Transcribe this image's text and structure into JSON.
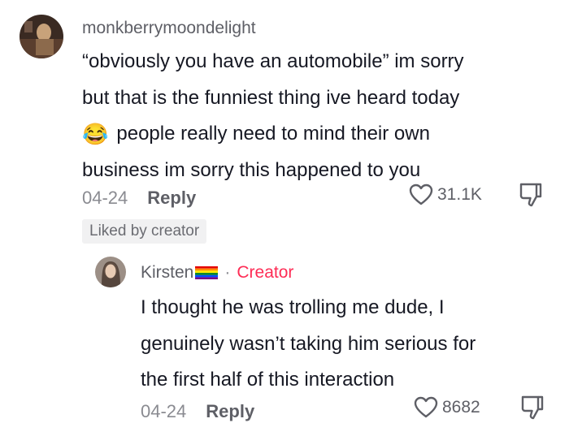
{
  "comment": {
    "username": "monkberrymoondelight",
    "lines": [
      "“obviously you have an automobile” im sorry",
      "but that is the funniest thing ive heard today",
      "people really need to mind their own",
      "business im sorry this happened to you"
    ],
    "emoji": "😂",
    "date": "04-24",
    "reply_label": "Reply",
    "likes": "31.1K",
    "liked_badge": "Liked by creator"
  },
  "reply": {
    "username": "Kirsten",
    "separator": "·",
    "creator_label": "Creator",
    "lines": [
      "I thought he was trolling me dude, I",
      "genuinely wasn’t taking him serious for",
      "the first half of this interaction"
    ],
    "date": "04-24",
    "reply_label": "Reply",
    "likes": "8682"
  },
  "colors": {
    "creator_accent": "#fe2c55",
    "meta_gray": "#8a8b91",
    "badge_bg": "#f1f1f2"
  },
  "icons": {
    "like": "heart-outline-icon",
    "dislike": "thumbs-down-icon",
    "flag": "rainbow-flag-icon"
  }
}
